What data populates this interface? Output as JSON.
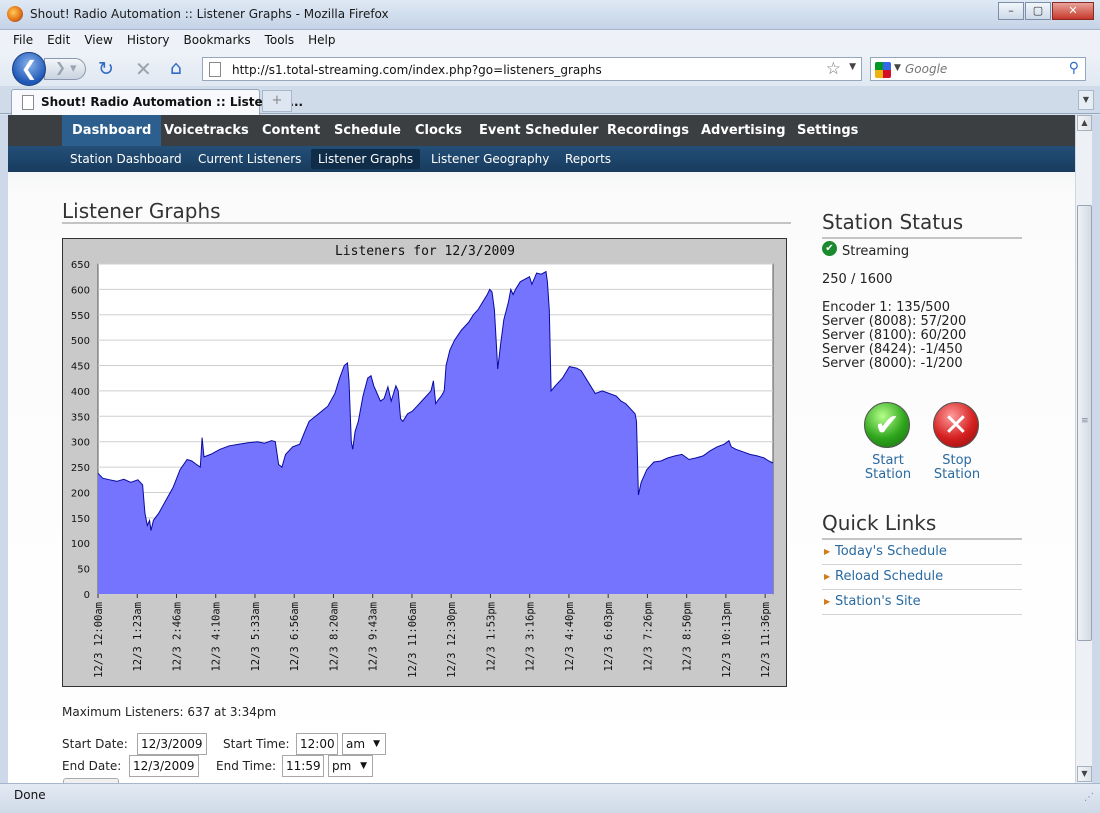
{
  "window": {
    "title": "Shout! Radio Automation :: Listener Graphs - Mozilla Firefox",
    "minimize": "–",
    "maximize": "▢",
    "close": "✕"
  },
  "menubar": {
    "items": [
      "File",
      "Edit",
      "View",
      "History",
      "Bookmarks",
      "Tools",
      "Help"
    ]
  },
  "navbar": {
    "back_glyph": "❮",
    "forward_glyph": "❯ ▾",
    "reload_glyph": "↻",
    "stop_glyph": "✕",
    "home_glyph": "⌂",
    "url": "http://s1.total-streaming.com/index.php?go=listeners_graphs",
    "bookmark_glyph": "☆",
    "url_dropdown_glyph": "▼",
    "search_placeholder": "Google",
    "search_dropdown_glyph": "▼",
    "search_glyph": "⚲"
  },
  "tabs": {
    "active_label": "Shout! Radio Automation :: Listener ...",
    "newtab_glyph": "+",
    "list_glyph": "▼"
  },
  "main_nav": {
    "items": [
      "Dashboard",
      "Voicetracks",
      "Content",
      "Schedule",
      "Clocks",
      "Event Scheduler",
      "Recordings",
      "Advertising",
      "Settings"
    ],
    "active": "Dashboard"
  },
  "sub_nav": {
    "items": [
      "Station Dashboard",
      "Current Listeners",
      "Listener Graphs",
      "Listener Geography",
      "Reports"
    ],
    "active": "Listener Graphs"
  },
  "page": {
    "title": "Listener Graphs",
    "max_listeners_text": "Maximum Listeners: 637 at 3:34pm",
    "form": {
      "start_date_label": "Start Date:",
      "start_date_value": "12/3/2009",
      "start_time_label": "Start Time:",
      "start_time_value": "12:00",
      "start_ampm": "am",
      "end_date_label": "End Date:",
      "end_date_value": "12/3/2009",
      "end_time_label": "End Time:",
      "end_time_value": "11:59",
      "end_ampm": "pm",
      "select_arrow": "▼"
    }
  },
  "chart_data": {
    "type": "area",
    "title": "Listeners for 12/3/2009",
    "fill_color": "#7474ff",
    "line_color": "#0a0aa0",
    "ylim": [
      0,
      650
    ],
    "yticks": [
      0,
      50,
      100,
      150,
      200,
      250,
      300,
      350,
      400,
      450,
      500,
      550,
      600,
      650
    ],
    "xlim_minutes": [
      0,
      1439
    ],
    "xtick_labels": [
      "12/3 12:00am",
      "12/3 1:23am",
      "12/3 2:46am",
      "12/3 4:10am",
      "12/3 5:33am",
      "12/3 6:56am",
      "12/3 8:20am",
      "12/3 9:43am",
      "12/3 11:06am",
      "12/3 12:30pm",
      "12/3 1:53pm",
      "12/3 3:16pm",
      "12/3 4:40pm",
      "12/3 6:03pm",
      "12/3 7:26pm",
      "12/3 8:50pm",
      "12/3 10:13pm",
      "12/3 11:36pm"
    ],
    "grid": true,
    "points": [
      [
        0,
        238
      ],
      [
        10,
        228
      ],
      [
        25,
        225
      ],
      [
        40,
        222
      ],
      [
        55,
        226
      ],
      [
        70,
        220
      ],
      [
        85,
        225
      ],
      [
        95,
        215
      ],
      [
        100,
        160
      ],
      [
        105,
        135
      ],
      [
        110,
        145
      ],
      [
        113,
        125
      ],
      [
        118,
        145
      ],
      [
        130,
        160
      ],
      [
        145,
        185
      ],
      [
        160,
        210
      ],
      [
        175,
        245
      ],
      [
        190,
        265
      ],
      [
        200,
        262
      ],
      [
        210,
        255
      ],
      [
        218,
        250
      ],
      [
        222,
        308
      ],
      [
        226,
        270
      ],
      [
        240,
        275
      ],
      [
        260,
        285
      ],
      [
        280,
        292
      ],
      [
        300,
        295
      ],
      [
        320,
        298
      ],
      [
        340,
        300
      ],
      [
        355,
        297
      ],
      [
        370,
        302
      ],
      [
        378,
        300
      ],
      [
        385,
        255
      ],
      [
        392,
        250
      ],
      [
        400,
        275
      ],
      [
        415,
        290
      ],
      [
        430,
        295
      ],
      [
        440,
        318
      ],
      [
        450,
        340
      ],
      [
        470,
        355
      ],
      [
        490,
        370
      ],
      [
        505,
        395
      ],
      [
        515,
        425
      ],
      [
        525,
        450
      ],
      [
        532,
        455
      ],
      [
        535,
        420
      ],
      [
        540,
        300
      ],
      [
        543,
        285
      ],
      [
        548,
        320
      ],
      [
        555,
        340
      ],
      [
        565,
        390
      ],
      [
        575,
        425
      ],
      [
        582,
        430
      ],
      [
        588,
        410
      ],
      [
        595,
        395
      ],
      [
        602,
        380
      ],
      [
        610,
        385
      ],
      [
        618,
        408
      ],
      [
        625,
        380
      ],
      [
        635,
        410
      ],
      [
        640,
        400
      ],
      [
        645,
        345
      ],
      [
        650,
        340
      ],
      [
        660,
        355
      ],
      [
        670,
        360
      ],
      [
        680,
        370
      ],
      [
        690,
        380
      ],
      [
        700,
        390
      ],
      [
        710,
        400
      ],
      [
        715,
        420
      ],
      [
        720,
        375
      ],
      [
        725,
        382
      ],
      [
        732,
        390
      ],
      [
        738,
        400
      ],
      [
        742,
        450
      ],
      [
        750,
        480
      ],
      [
        760,
        500
      ],
      [
        775,
        520
      ],
      [
        790,
        535
      ],
      [
        800,
        550
      ],
      [
        810,
        560
      ],
      [
        820,
        575
      ],
      [
        830,
        590
      ],
      [
        835,
        600
      ],
      [
        840,
        595
      ],
      [
        845,
        560
      ],
      [
        850,
        480
      ],
      [
        852,
        443
      ],
      [
        858,
        490
      ],
      [
        865,
        540
      ],
      [
        875,
        575
      ],
      [
        880,
        600
      ],
      [
        885,
        590
      ],
      [
        890,
        600
      ],
      [
        900,
        615
      ],
      [
        910,
        620
      ],
      [
        920,
        625
      ],
      [
        925,
        610
      ],
      [
        935,
        632
      ],
      [
        945,
        630
      ],
      [
        955,
        635
      ],
      [
        958,
        615
      ],
      [
        962,
        560
      ],
      [
        966,
        400
      ],
      [
        975,
        410
      ],
      [
        990,
        425
      ],
      [
        1005,
        448
      ],
      [
        1020,
        445
      ],
      [
        1030,
        440
      ],
      [
        1040,
        425
      ],
      [
        1050,
        410
      ],
      [
        1060,
        395
      ],
      [
        1075,
        400
      ],
      [
        1090,
        395
      ],
      [
        1105,
        390
      ],
      [
        1115,
        380
      ],
      [
        1125,
        375
      ],
      [
        1135,
        365
      ],
      [
        1140,
        360
      ],
      [
        1145,
        355
      ],
      [
        1148,
        340
      ],
      [
        1152,
        195
      ],
      [
        1158,
        220
      ],
      [
        1170,
        245
      ],
      [
        1185,
        260
      ],
      [
        1200,
        262
      ],
      [
        1215,
        268
      ],
      [
        1230,
        272
      ],
      [
        1245,
        275
      ],
      [
        1260,
        265
      ],
      [
        1275,
        268
      ],
      [
        1290,
        272
      ],
      [
        1305,
        282
      ],
      [
        1320,
        290
      ],
      [
        1335,
        295
      ],
      [
        1345,
        302
      ],
      [
        1350,
        290
      ],
      [
        1360,
        285
      ],
      [
        1375,
        280
      ],
      [
        1390,
        275
      ],
      [
        1405,
        272
      ],
      [
        1420,
        268
      ],
      [
        1430,
        262
      ],
      [
        1439,
        258
      ]
    ]
  },
  "sidebar": {
    "status_title": "Station Status",
    "check_glyph": "✔",
    "streaming_label": "Streaming",
    "capacity": "250 / 1600",
    "encoders": [
      "Encoder 1: 135/500",
      "Server (8008): 57/200",
      "Server (8100): 60/200",
      "Server (8424): -1/450",
      "Server (8000): -1/200"
    ],
    "start_glyph": "✔",
    "start_label_1": "Start",
    "start_label_2": "Station",
    "stop_glyph": "✕",
    "stop_label_1": "Stop",
    "stop_label_2": "Station",
    "quick_links_title": "Quick Links",
    "link_bullet": "▶",
    "quick_links": [
      "Today's Schedule",
      "Reload Schedule",
      "Station's Site"
    ]
  },
  "scrollbar": {
    "up_glyph": "▲",
    "down_glyph": "▼",
    "grip_glyph": "≡"
  },
  "statusbar": {
    "text": "Done",
    "resize_glyph": "⋰"
  }
}
